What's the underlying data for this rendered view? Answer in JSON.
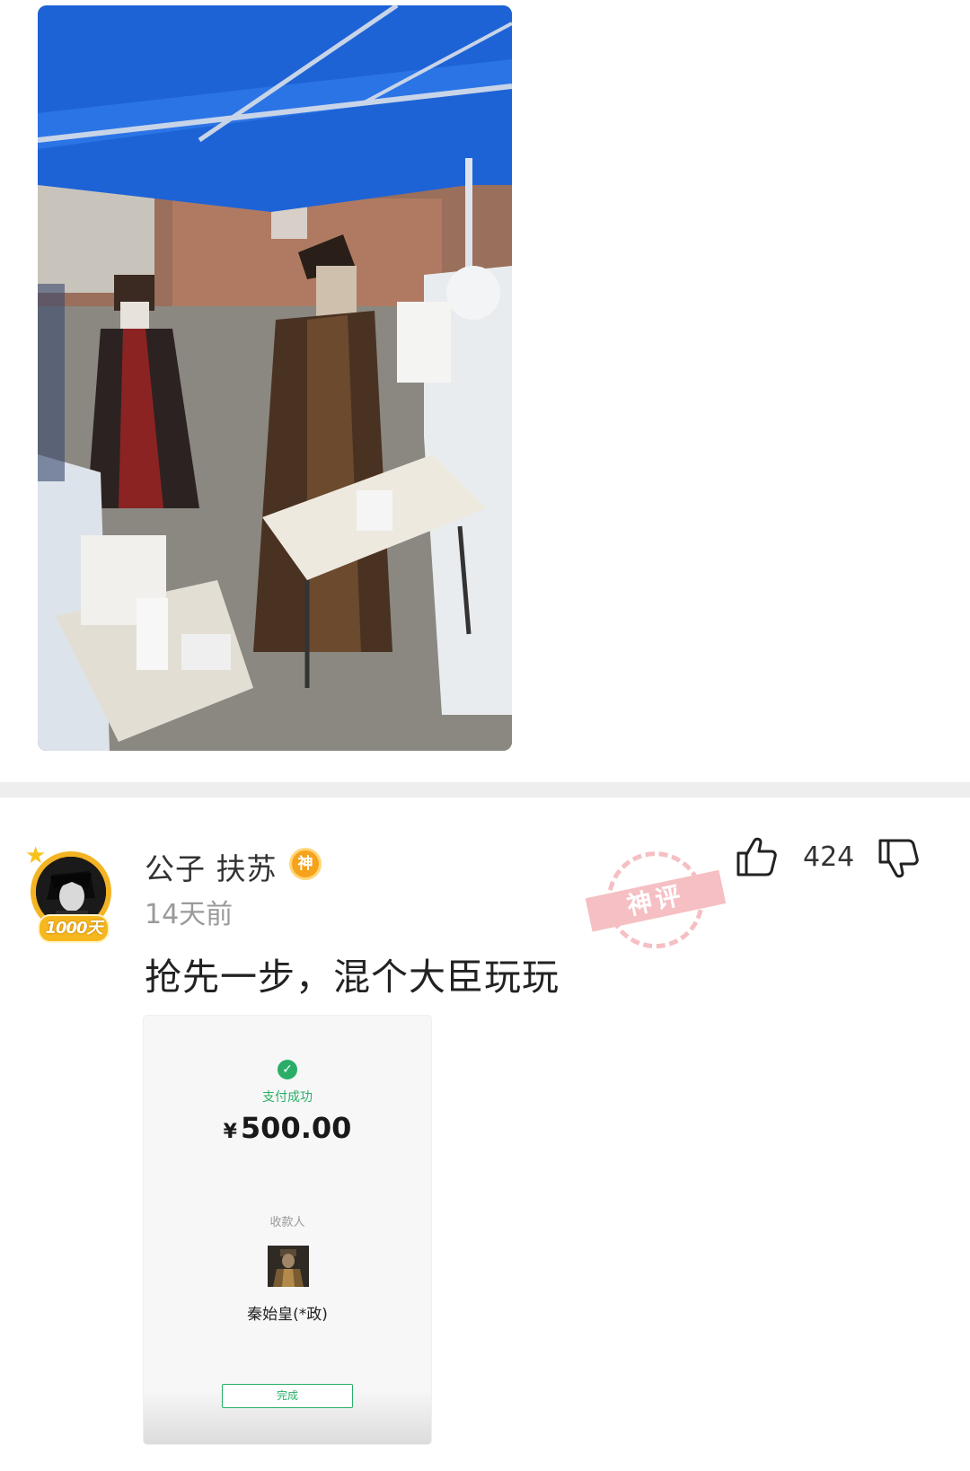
{
  "comment": {
    "username": "公子 扶苏",
    "badge_text": "神",
    "level_badge": "1000天",
    "timestamp": "14天前",
    "text": "抢先一步，混个大臣玩玩",
    "stamp_text": "神评",
    "like_count": "424"
  },
  "receipt": {
    "status": "支付成功",
    "currency": "¥",
    "amount": "500.00",
    "payee_label": "收款人",
    "payee_name": "秦始皇(*政)",
    "done_label": "完成"
  }
}
